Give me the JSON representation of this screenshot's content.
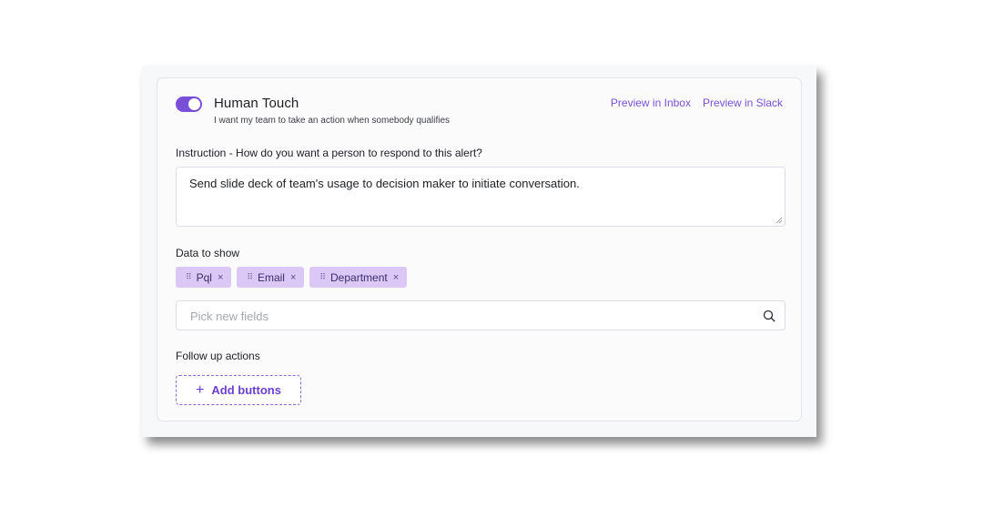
{
  "header": {
    "title": "Human Touch",
    "subtitle": "I want my team to take an action when somebody qualifies",
    "toggle_on": true,
    "preview_inbox": "Preview in Inbox",
    "preview_slack": "Preview in Slack"
  },
  "instruction": {
    "label": "Instruction - How do you want a person to respond to this alert?",
    "value": "Send slide deck of team's usage to decision maker to initiate conversation."
  },
  "data_to_show": {
    "label": "Data to show",
    "chips": [
      {
        "label": "Pql"
      },
      {
        "label": "Email"
      },
      {
        "label": "Department"
      }
    ],
    "search_placeholder": "Pick new fields"
  },
  "follow_up": {
    "label": "Follow up actions",
    "add_button": "Add buttons"
  },
  "icons": {
    "grip": "drag-grip-icon",
    "remove": "close-icon",
    "search": "search-icon",
    "plus": "plus-icon"
  },
  "colors": {
    "accent": "#7a4fd8",
    "chip_bg": "#dcc8f7"
  }
}
